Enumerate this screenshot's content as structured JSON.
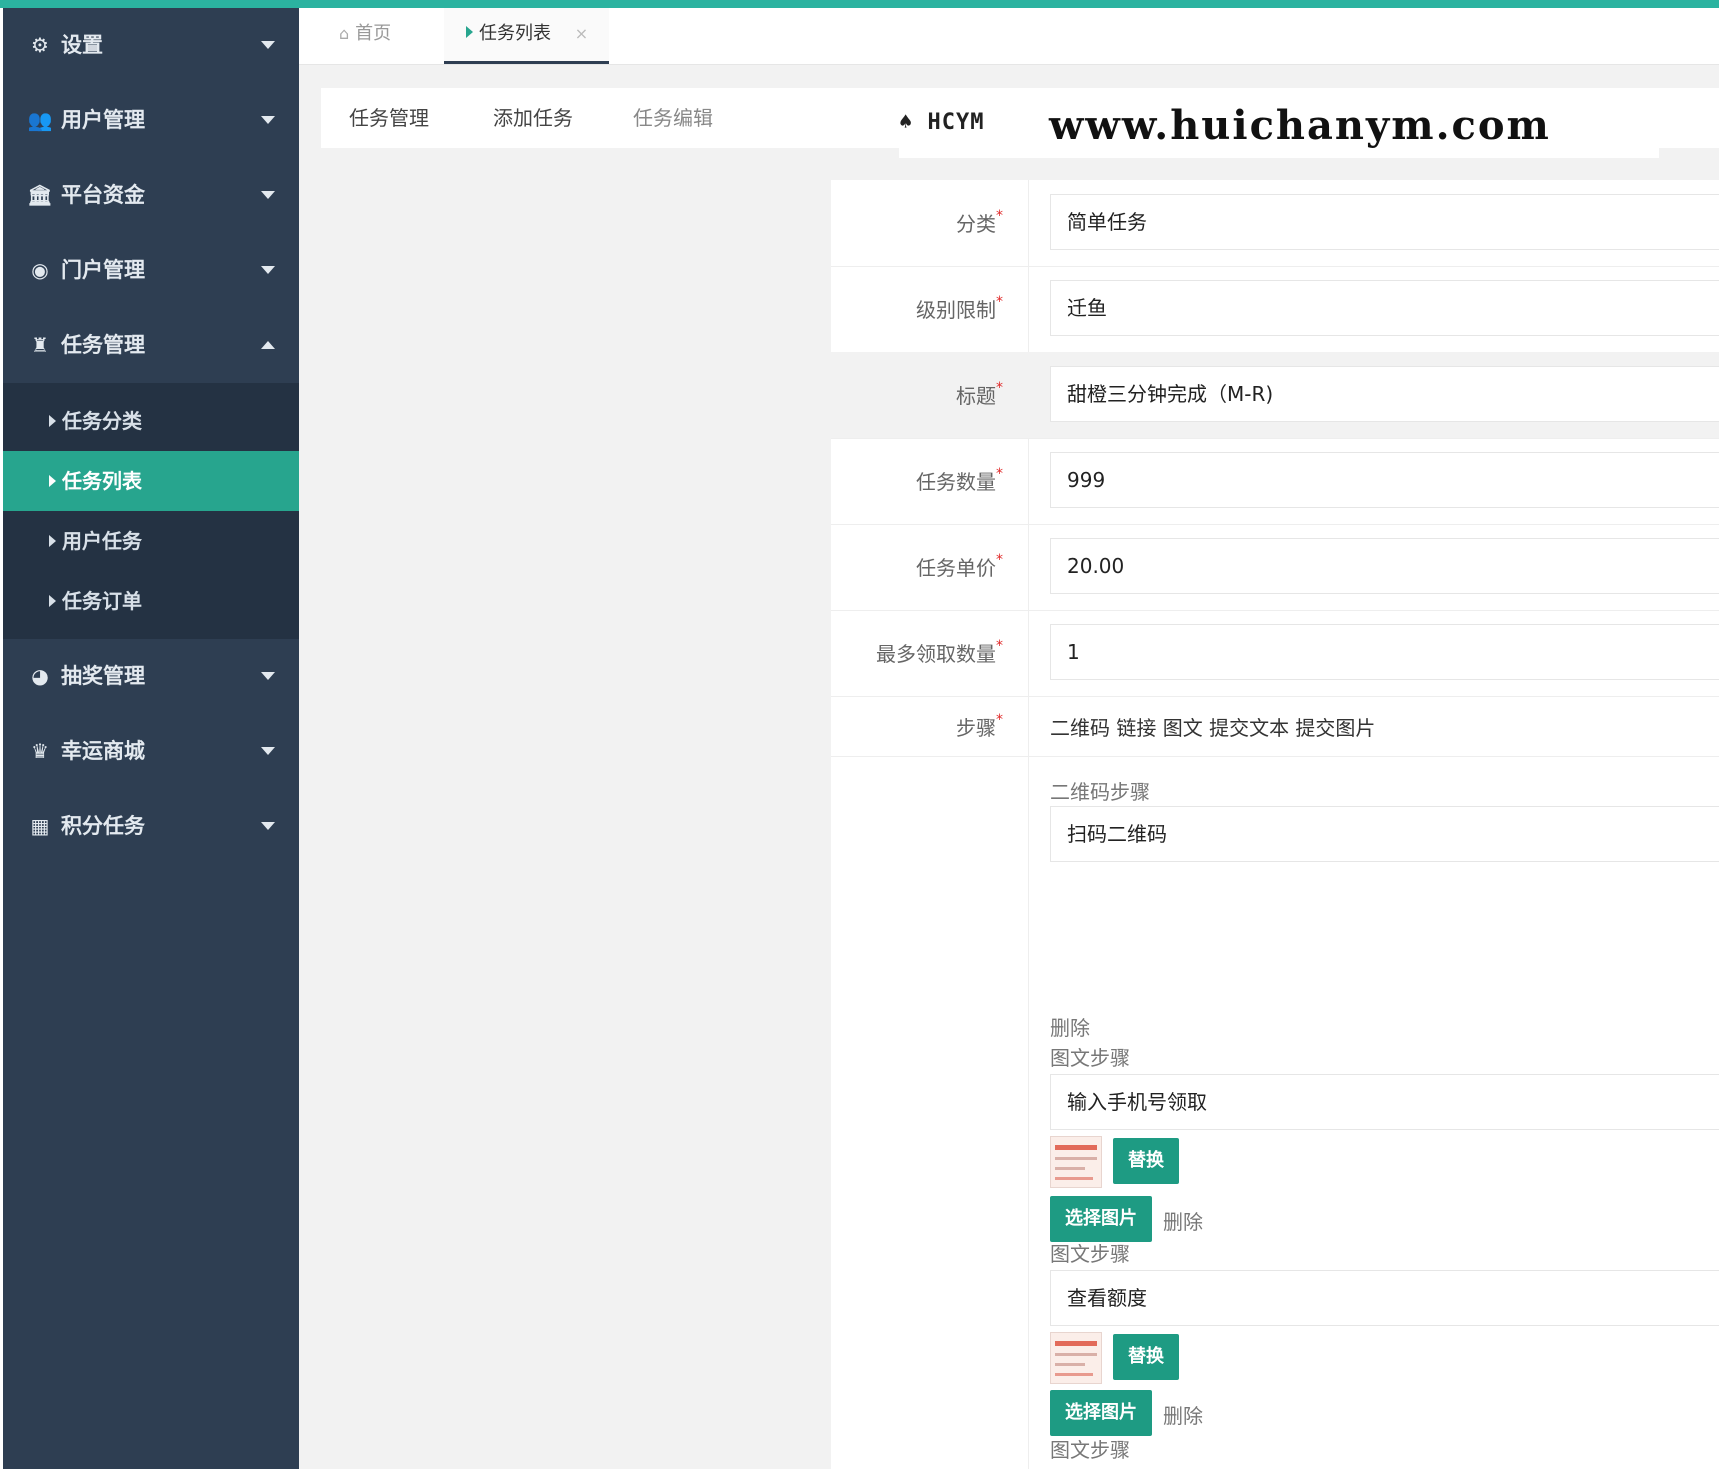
{
  "sidebar": {
    "menus": [
      {
        "label": "设置",
        "icon": "gears-icon"
      },
      {
        "label": "用户管理",
        "icon": "users-icon"
      },
      {
        "label": "平台资金",
        "icon": "bank-icon"
      },
      {
        "label": "门户管理",
        "icon": "globe-icon"
      },
      {
        "label": "任务管理",
        "icon": "task-icon"
      },
      {
        "label": "抽奖管理",
        "icon": "lottery-icon"
      },
      {
        "label": "幸运商城",
        "icon": "shop-icon"
      },
      {
        "label": "积分任务",
        "icon": "grid-icon"
      }
    ],
    "submenu": [
      {
        "label": "任务分类"
      },
      {
        "label": "任务列表"
      },
      {
        "label": "用户任务"
      },
      {
        "label": "任务订单"
      }
    ]
  },
  "tabs": {
    "home": "首页",
    "current": "任务列表",
    "close": "×"
  },
  "subtabs": [
    "任务管理",
    "添加任务",
    "任务编辑"
  ],
  "watermark": {
    "logo": "HCYM",
    "url": "www.huichanym.com"
  },
  "form": {
    "required_mark": "*",
    "category": {
      "label": "分类",
      "value": "简单任务"
    },
    "level": {
      "label": "级别限制",
      "value": "迁鱼"
    },
    "title": {
      "label": "标题",
      "value": "甜橙三分钟完成（M-R)"
    },
    "quantity": {
      "label": "任务数量",
      "value": "999"
    },
    "price": {
      "label": "任务单价",
      "value": "20.00"
    },
    "max_claim": {
      "label": "最多领取数量",
      "value": "1"
    },
    "steps": {
      "label": "步骤",
      "options": "二维码 链接 图文 提交文本 提交图片"
    },
    "step_blocks": {
      "qr_title": "二维码步骤",
      "qr_value": "扫码二维码",
      "delete": "删除",
      "img_title": "图文步骤",
      "img1_value": "输入手机号领取",
      "img2_value": "查看额度",
      "replace": "替换",
      "choose": "选择图片"
    }
  },
  "colors": {
    "sidebar": "#2e3e52",
    "accent": "#27a58e",
    "button": "#1e9b83",
    "required": "#e02828"
  }
}
